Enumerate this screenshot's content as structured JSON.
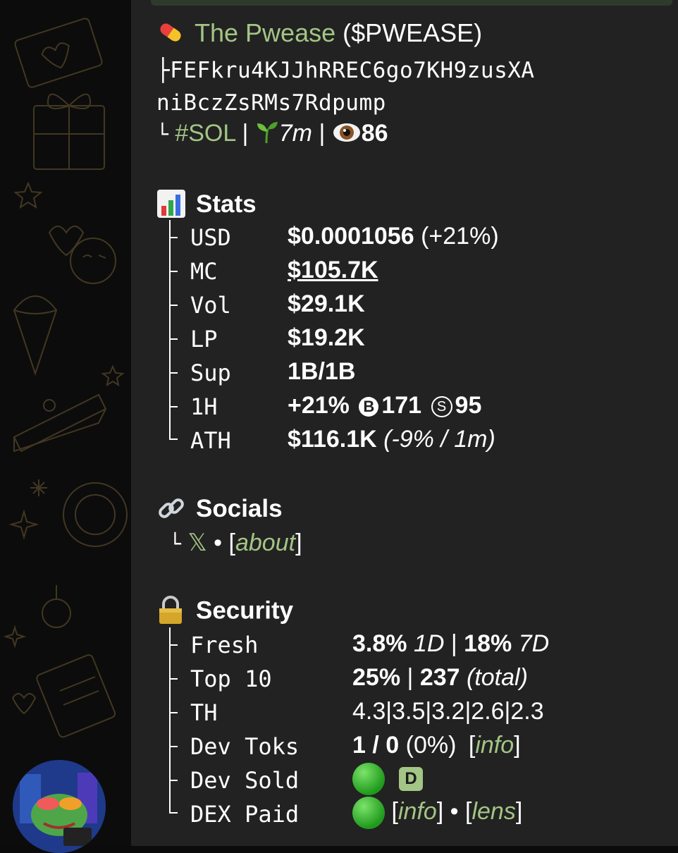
{
  "token": {
    "name": "The Pwease",
    "ticker": "($PWEASE)",
    "address_line1": "FEFkru4KJJhRREC6go7KH9zusXA",
    "address_line2": "niBczZsRMs7Rdpump",
    "chain": "#SOL",
    "age": "7m",
    "views": "86"
  },
  "stats": {
    "title": "Stats",
    "rows": [
      {
        "label": "USD",
        "value": "$0.0001056",
        "extra": "(+21%)"
      },
      {
        "label": "MC",
        "value": "$105.7K"
      },
      {
        "label": "Vol",
        "value": "$29.1K"
      },
      {
        "label": "LP",
        "value": "$19.2K"
      },
      {
        "label": "Sup",
        "value": "1B/1B"
      },
      {
        "label": "1H",
        "value": "+21%",
        "b_badge": "B",
        "buys": "171",
        "s_badge": "S",
        "sells": "95"
      },
      {
        "label": "ATH",
        "value": "$116.1K",
        "extra": "(-9% / 1m)"
      }
    ]
  },
  "socials": {
    "title": "Socials",
    "x_label": "𝕏",
    "separator": "•",
    "about_open": "[",
    "about": "about",
    "about_close": "]"
  },
  "security": {
    "title": "Security",
    "fresh_label": "Fresh",
    "fresh_a": "3.8%",
    "fresh_a_unit": "1D",
    "fresh_b": "18%",
    "fresh_b_unit": "7D",
    "top10_label": "Top 10",
    "top10_a": "25%",
    "top10_b": "237",
    "top10_b_unit": "(total)",
    "th_label": "TH",
    "th_value": "4.3|3.5|3.2|2.6|2.3",
    "devtoks_label": "Dev Toks",
    "devtoks_value": "1 / 0",
    "devtoks_pct": "(0%)",
    "devtoks_info": "info",
    "devsold_label": "Dev Sold",
    "devsold_badge": "D",
    "dexpaid_label": "DEX Paid",
    "dexpaid_info": "info",
    "dexpaid_sep": "•",
    "dexpaid_lens": "lens"
  },
  "colors": {
    "accent_green": "#a3c585",
    "bubble_bg": "#222222",
    "status_green": "#2fb82a"
  },
  "icons": {
    "pill": "pill-icon",
    "seedling": "seedling-icon",
    "eye": "eye-icon",
    "chart": "bar-chart-icon",
    "link": "link-icon",
    "lock": "lock-icon"
  }
}
